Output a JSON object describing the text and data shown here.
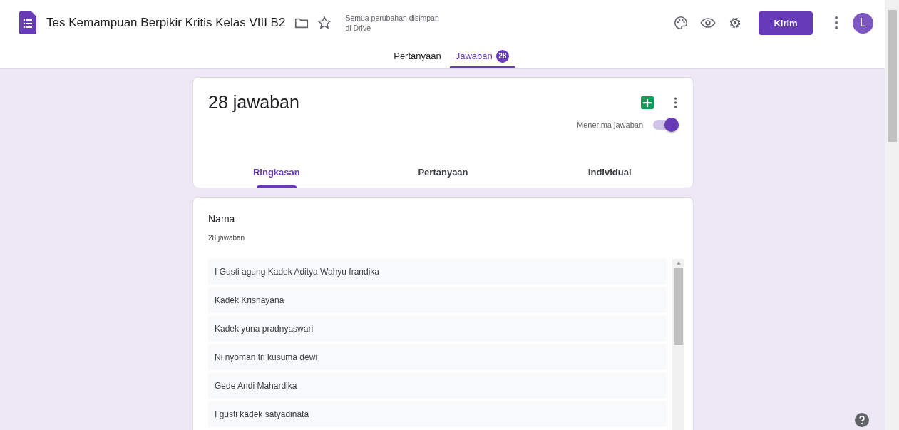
{
  "header": {
    "title": "Tes Kemampuan Berpikir Kritis Kelas VIII B2",
    "save_status": "Semua perubahan disimpan di Drive",
    "send_button": "Kirim",
    "avatar": "L"
  },
  "tabs": [
    {
      "label": "Pertanyaan",
      "selected": false
    },
    {
      "label": "Jawaban",
      "selected": true,
      "badge": "28"
    }
  ],
  "summary": {
    "title": "28 jawaban",
    "accepting_label": "Menerima jawaban",
    "accepting": true,
    "subtabs": [
      {
        "label": "Ringkasan",
        "selected": true
      },
      {
        "label": "Pertanyaan",
        "selected": false
      },
      {
        "label": "Individual",
        "selected": false
      }
    ]
  },
  "question": {
    "title": "Nama",
    "count": "28 jawaban",
    "answers": [
      "I Gusti agung Kadek Aditya Wahyu frandika",
      "Kadek Krisnayana",
      "Kadek yuna pradnyaswari",
      "Ni nyoman tri kusuma dewi",
      "Gede Andi Mahardika",
      "I gusti kadek satyadinata"
    ]
  }
}
